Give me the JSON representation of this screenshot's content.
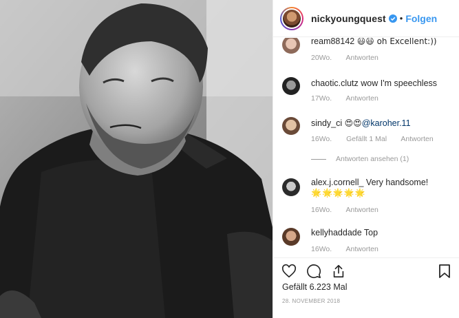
{
  "header": {
    "username": "nickyoungquest",
    "dot": "•",
    "follow_label": "Folgen"
  },
  "comments": [
    {
      "user": "ream88142",
      "text": "😃😃 oh Excellent:))",
      "age": "20Wo.",
      "reply": "Antworten"
    },
    {
      "user": "chaotic.clutz",
      "text": "wow I'm speechless",
      "age": "17Wo.",
      "reply": "Antworten"
    },
    {
      "user": "sindy_ci",
      "emoji": "😍😍",
      "mention": "@karoher.11",
      "age": "16Wo.",
      "likes": "Gefällt 1 Mal",
      "reply": "Antworten",
      "view_replies": "Antworten ansehen (1)"
    },
    {
      "user": "alex.j.cornell_",
      "text": "Very handsome!",
      "text2": "🌟🌟🌟🌟🌟",
      "age": "16Wo.",
      "reply": "Antworten"
    },
    {
      "user": "kellyhaddade",
      "text": "Top",
      "age": "16Wo.",
      "reply": "Antworten"
    }
  ],
  "post": {
    "likes_text": "Gefällt 6.223 Mal",
    "date": "28. NOVEMBER 2018"
  },
  "icons": {
    "like": "heart-icon",
    "comment": "comment-icon",
    "share": "share-icon",
    "save": "bookmark-icon",
    "verified": "verified-badge-icon"
  },
  "colors": {
    "link": "#3897f0",
    "verified": "#3897f0",
    "meta": "#999999",
    "text": "#262626",
    "mention": "#003569"
  }
}
